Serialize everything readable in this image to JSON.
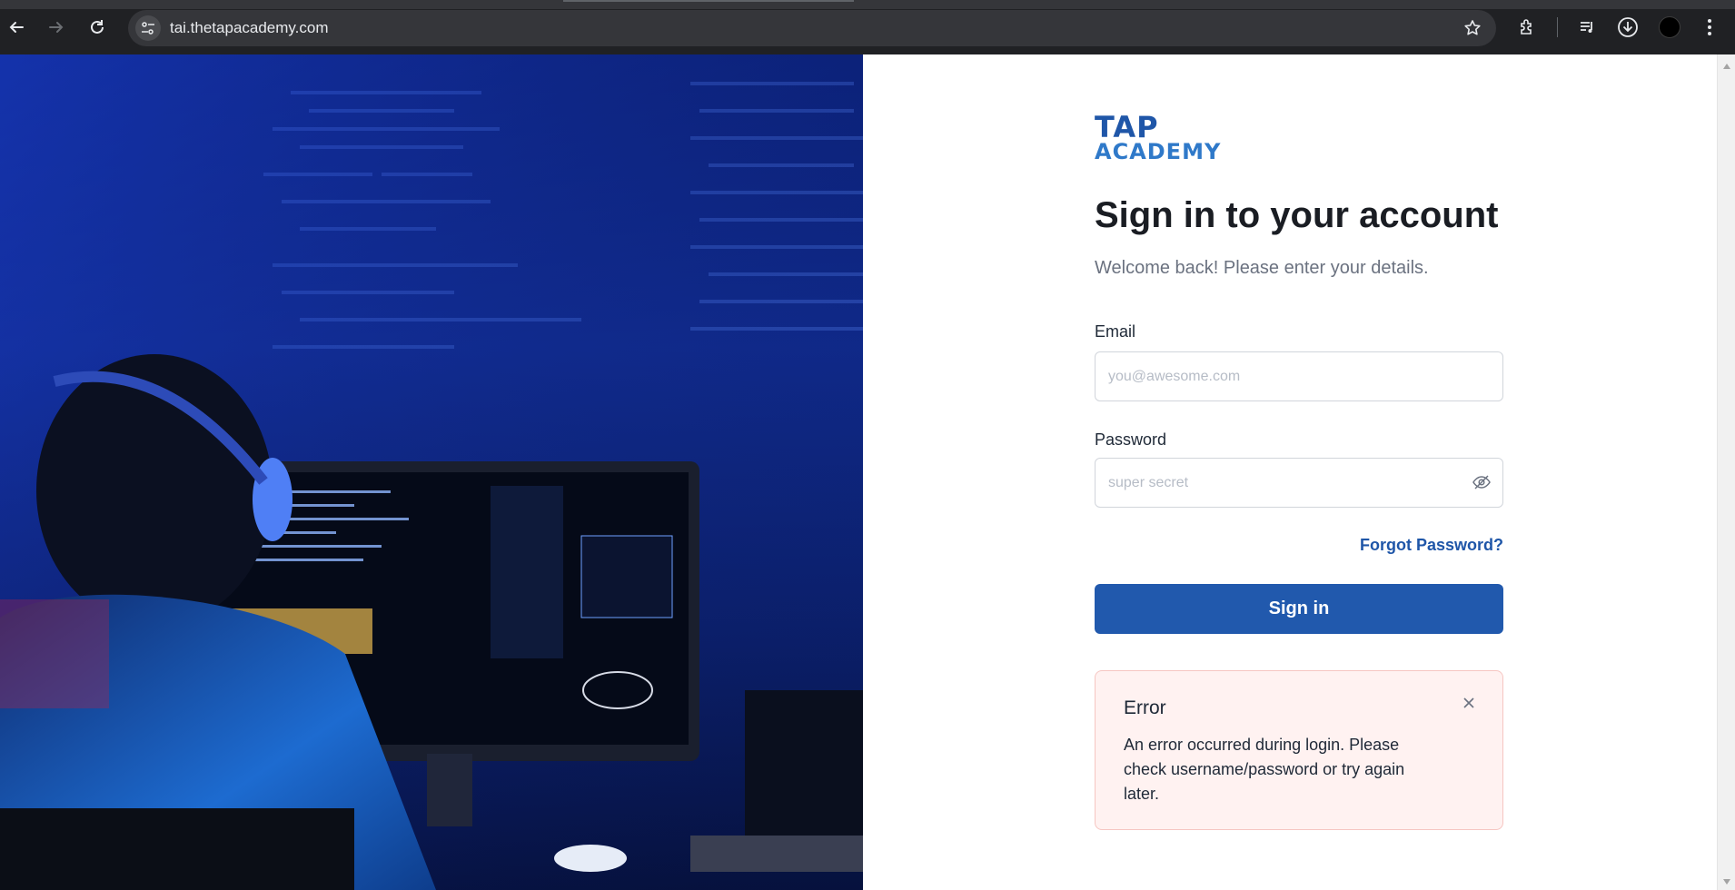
{
  "browser": {
    "url": "tai.thetapacademy.com",
    "icons": [
      "back-icon",
      "forward-icon",
      "reload-icon",
      "site-info-icon",
      "bookmark-star-icon",
      "extensions-icon",
      "media-icon",
      "download-icon",
      "profile-avatar",
      "menu-icon"
    ]
  },
  "brand": {
    "logo_line1": "TAP",
    "logo_line2": "ACADEMY",
    "primary_color": "#2159ad"
  },
  "login": {
    "title": "Sign in to your account",
    "subtitle": "Welcome back! Please enter your details.",
    "email_label": "Email",
    "email_placeholder": "you@awesome.com",
    "email_value": "",
    "password_label": "Password",
    "password_placeholder": "super secret",
    "password_value": "",
    "forgot_label": "Forgot Password?",
    "signin_label": "Sign in"
  },
  "error": {
    "title": "Error",
    "message": "An error occurred during login. Please check username/password or try again later.",
    "bg_color": "#fff2f1"
  }
}
